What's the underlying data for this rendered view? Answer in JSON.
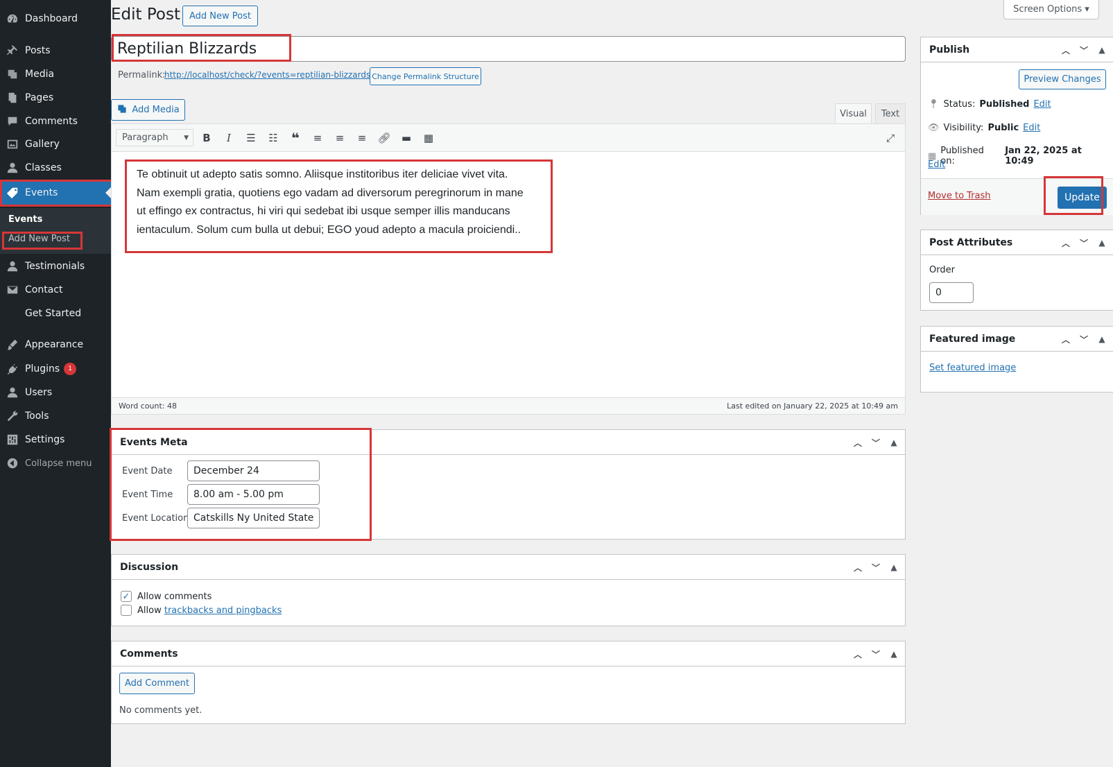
{
  "sidebar": {
    "items": [
      {
        "label": "Dashboard",
        "icon": "dashboard-icon"
      },
      {
        "label": "Posts",
        "icon": "pin-icon"
      },
      {
        "label": "Media",
        "icon": "media-icon"
      },
      {
        "label": "Pages",
        "icon": "pages-icon"
      },
      {
        "label": "Comments",
        "icon": "comment-icon"
      },
      {
        "label": "Gallery",
        "icon": "gallery-icon"
      },
      {
        "label": "Classes",
        "icon": "user-icon"
      },
      {
        "label": "Events",
        "icon": "tag-icon"
      },
      {
        "label": "Testimonials",
        "icon": "user-icon"
      },
      {
        "label": "Contact",
        "icon": "mail-icon"
      },
      {
        "label": "Get Started",
        "icon": ""
      },
      {
        "label": "Appearance",
        "icon": "brush-icon"
      },
      {
        "label": "Plugins",
        "icon": "plugin-icon",
        "badge": "1"
      },
      {
        "label": "Users",
        "icon": "user-icon"
      },
      {
        "label": "Tools",
        "icon": "wrench-icon"
      },
      {
        "label": "Settings",
        "icon": "settings-icon"
      }
    ],
    "submenu": {
      "current": "Events",
      "add_new": "Add New Post"
    },
    "collapse_label": "Collapse menu"
  },
  "header": {
    "title": "Edit Post",
    "add_new_label": "Add New Post",
    "screen_options": "Screen Options ▾"
  },
  "post": {
    "title": "Reptilian Blizzards",
    "permalink_label": "Permalink:",
    "permalink_url": "http://localhost/check/?events=reptilian-blizzards",
    "change_permalink": "Change Permalink Structure",
    "add_media": "Add Media",
    "tab_visual": "Visual",
    "tab_text": "Text",
    "format_select": "Paragraph",
    "content": "Te obtinuit ut adepto satis somno. Aliisque institoribus iter deliciae vivet vita. Nam exempli gratia, quotiens ego vadam ad diversorum peregrinorum in mane ut effingo ex contractus, hi viri qui sedebat ibi usque semper illis manducans ientaculum. Solum cum bulla ut debui; EGO youd adepto a macula proiciendi..",
    "word_count": "Word count: 48",
    "last_edited": "Last edited on January 22, 2025 at 10:49 am"
  },
  "events_meta": {
    "title": "Events Meta",
    "date_label": "Event Date",
    "date_value": "December 24",
    "time_label": "Event Time",
    "time_value": "8.00 am - 5.00 pm",
    "location_label": "Event Location",
    "location_value": "Catskills Ny United State"
  },
  "discussion": {
    "title": "Discussion",
    "allow_comments": "Allow comments",
    "allow_prefix": "Allow",
    "trackbacks_link": "trackbacks and pingbacks"
  },
  "comments": {
    "title": "Comments",
    "add_comment": "Add Comment",
    "empty": "No comments yet."
  },
  "publish": {
    "title": "Publish",
    "preview": "Preview Changes",
    "status_label": "Status:",
    "status_value": "Published",
    "visibility_label": "Visibility:",
    "visibility_value": "Public",
    "published_label": "Published on:",
    "published_value": "Jan 22, 2025 at 10:49",
    "edit": "Edit",
    "trash": "Move to Trash",
    "update": "Update"
  },
  "attributes": {
    "title": "Post Attributes",
    "order_label": "Order",
    "order_value": "0"
  },
  "featured": {
    "title": "Featured image",
    "set_link": "Set featured image"
  }
}
